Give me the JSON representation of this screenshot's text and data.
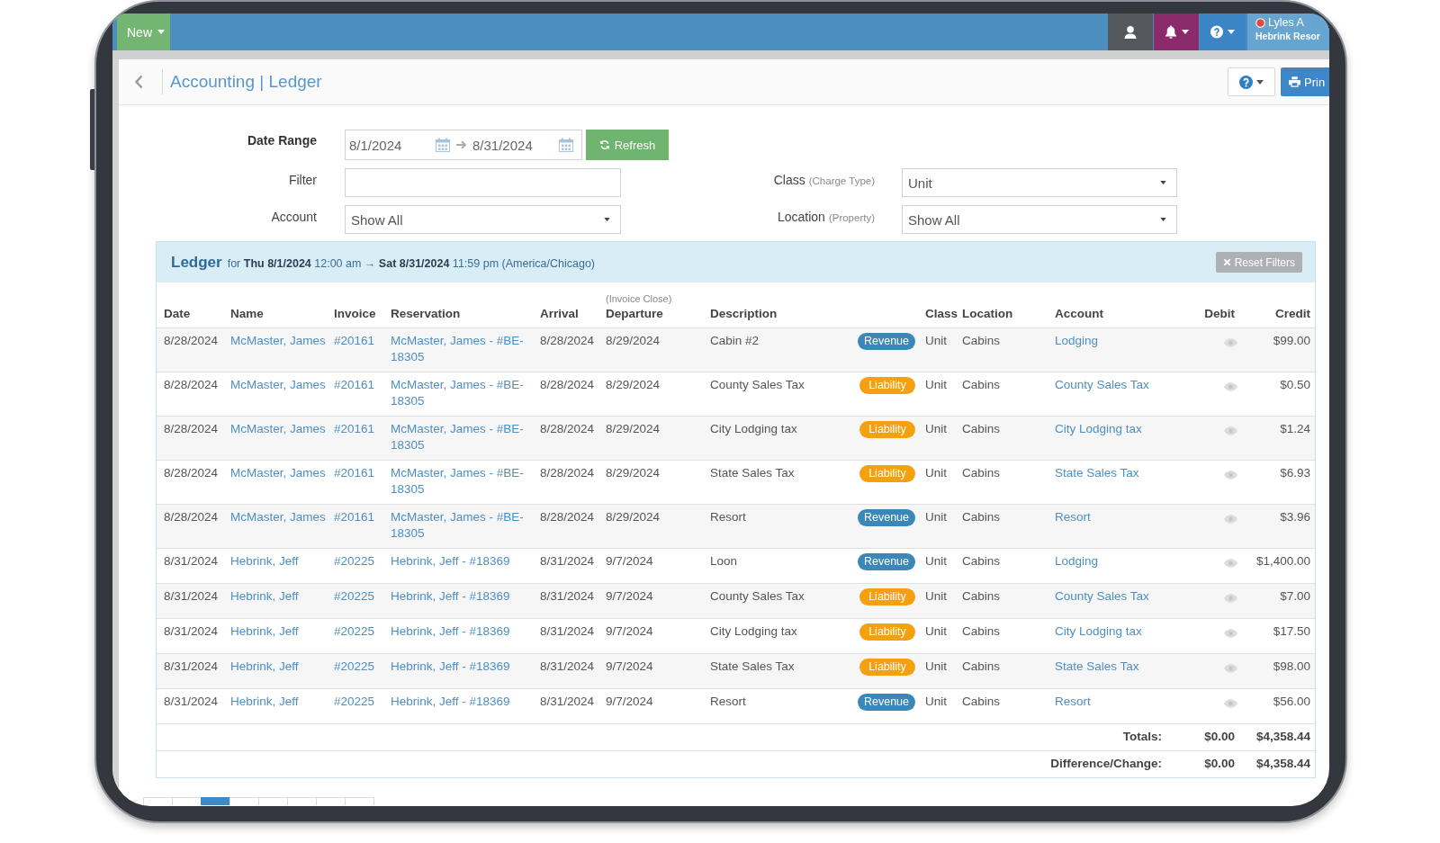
{
  "top_bar": {
    "new_button": "New",
    "user_name": "Lyles A",
    "property": "Hebrink Resor"
  },
  "header": {
    "title": "Accounting | Ledger",
    "print_button": "Prin"
  },
  "filters": {
    "date_range": {
      "label": "Date Range",
      "start": "8/1/2024",
      "end": "8/31/2024",
      "refresh_button": "Refresh"
    },
    "filter": {
      "label": "Filter"
    },
    "class": {
      "label": "Class",
      "hint": "(Charge Type)",
      "value": "Unit"
    },
    "account": {
      "label": "Account",
      "value": "Show All"
    },
    "location": {
      "label": "Location",
      "hint": "(Property)",
      "value": "Show All"
    }
  },
  "ledger": {
    "title": "Ledger",
    "range": "for **Thu 8/1/2024** 12:00 am → **Sat 8/31/2024** 11:59 pm (America/Chicago)",
    "reset_button": "Reset Filters",
    "columns": [
      {
        "label": "Date"
      },
      {
        "label": "Name"
      },
      {
        "label": "Invoice"
      },
      {
        "label": "Reservation"
      },
      {
        "label": "Arrival"
      },
      {
        "note": "(Invoice Close)",
        "label": "Departure"
      },
      {
        "label": "Description"
      },
      {
        "label": "Class"
      },
      {
        "label": "Location"
      },
      {
        "label": "Account"
      },
      {
        "label": "Debit"
      },
      {
        "label": "Credit"
      }
    ],
    "rows": [
      {
        "date": "8/28/2024",
        "name": "McMaster, James",
        "invoice": "#20161",
        "reservation": "McMaster, James - #BE-18305",
        "arrival": "8/28/2024",
        "departure": "8/29/2024",
        "description": "Cabin #2",
        "badge": {
          "label": "Revenue",
          "color": "#3b88b8"
        },
        "class": "Unit",
        "location": "Cabins",
        "account": "Lodging",
        "credit": "$99.00"
      },
      {
        "date": "8/28/2024",
        "name": "McMaster, James",
        "invoice": "#20161",
        "reservation": "McMaster, James - #BE-18305",
        "arrival": "8/28/2024",
        "departure": "8/29/2024",
        "description": "County Sales Tax",
        "badge": {
          "label": "Liability",
          "color": "#f5a011"
        },
        "class": "Unit",
        "location": "Cabins",
        "account": "County Sales Tax",
        "credit": "$0.50"
      },
      {
        "date": "8/28/2024",
        "name": "McMaster, James",
        "invoice": "#20161",
        "reservation": "McMaster, James - #BE-18305",
        "arrival": "8/28/2024",
        "departure": "8/29/2024",
        "description": "City Lodging tax",
        "badge": {
          "label": "Liability",
          "color": "#f5a011"
        },
        "class": "Unit",
        "location": "Cabins",
        "account": "City Lodging tax",
        "credit": "$1.24"
      },
      {
        "date": "8/28/2024",
        "name": "McMaster, James",
        "invoice": "#20161",
        "reservation": "McMaster, James - #BE-18305",
        "arrival": "8/28/2024",
        "departure": "8/29/2024",
        "description": "State Sales Tax",
        "badge": {
          "label": "Liability",
          "color": "#f5a011"
        },
        "class": "Unit",
        "location": "Cabins",
        "account": "State Sales Tax",
        "credit": "$6.93"
      },
      {
        "date": "8/28/2024",
        "name": "McMaster, James",
        "invoice": "#20161",
        "reservation": "McMaster, James - #BE-18305",
        "arrival": "8/28/2024",
        "departure": "8/29/2024",
        "description": "Resort",
        "badge": {
          "label": "Revenue",
          "color": "#3b88b8"
        },
        "class": "Unit",
        "location": "Cabins",
        "account": "Resort",
        "credit": "$3.96"
      },
      {
        "date": "8/31/2024",
        "name": "Hebrink, Jeff",
        "invoice": "#20225",
        "reservation": "Hebrink, Jeff - #18369",
        "arrival": "8/31/2024",
        "departure": "9/7/2024",
        "description": "Loon",
        "badge": {
          "label": "Revenue",
          "color": "#3b88b8"
        },
        "class": "Unit",
        "location": "Cabins",
        "account": "Lodging",
        "credit": "$1,400.00"
      },
      {
        "date": "8/31/2024",
        "name": "Hebrink, Jeff",
        "invoice": "#20225",
        "reservation": "Hebrink, Jeff - #18369",
        "arrival": "8/31/2024",
        "departure": "9/7/2024",
        "description": "County Sales Tax",
        "badge": {
          "label": "Liability",
          "color": "#f5a011"
        },
        "class": "Unit",
        "location": "Cabins",
        "account": "County Sales Tax",
        "credit": "$7.00"
      },
      {
        "date": "8/31/2024",
        "name": "Hebrink, Jeff",
        "invoice": "#20225",
        "reservation": "Hebrink, Jeff - #18369",
        "arrival": "8/31/2024",
        "departure": "9/7/2024",
        "description": "City Lodging tax",
        "badge": {
          "label": "Liability",
          "color": "#f5a011"
        },
        "class": "Unit",
        "location": "Cabins",
        "account": "City Lodging tax",
        "credit": "$17.50"
      },
      {
        "date": "8/31/2024",
        "name": "Hebrink, Jeff",
        "invoice": "#20225",
        "reservation": "Hebrink, Jeff - #18369",
        "arrival": "8/31/2024",
        "departure": "9/7/2024",
        "description": "State Sales Tax",
        "badge": {
          "label": "Liability",
          "color": "#f5a011"
        },
        "class": "Unit",
        "location": "Cabins",
        "account": "State Sales Tax",
        "credit": "$98.00"
      },
      {
        "date": "8/31/2024",
        "name": "Hebrink, Jeff",
        "invoice": "#20225",
        "reservation": "Hebrink, Jeff - #18369",
        "arrival": "8/31/2024",
        "departure": "9/7/2024",
        "description": "Resort",
        "badge": {
          "label": "Revenue",
          "color": "#3b88b8"
        },
        "class": "Unit",
        "location": "Cabins",
        "account": "Resort",
        "credit": "$56.00"
      }
    ],
    "totals": [
      {
        "label": "Totals:",
        "debit": "$0.00",
        "credit": "$4,358.44"
      },
      {
        "label": "Difference/Change:",
        "debit": "$0.00",
        "credit": "$4,358.44"
      }
    ]
  },
  "pagination": [
    {
      "selected": false
    },
    {
      "selected": false
    },
    {
      "selected": true
    },
    {
      "selected": false
    },
    {
      "selected": false
    },
    {
      "selected": false
    },
    {
      "selected": false
    },
    {
      "selected": false
    }
  ]
}
